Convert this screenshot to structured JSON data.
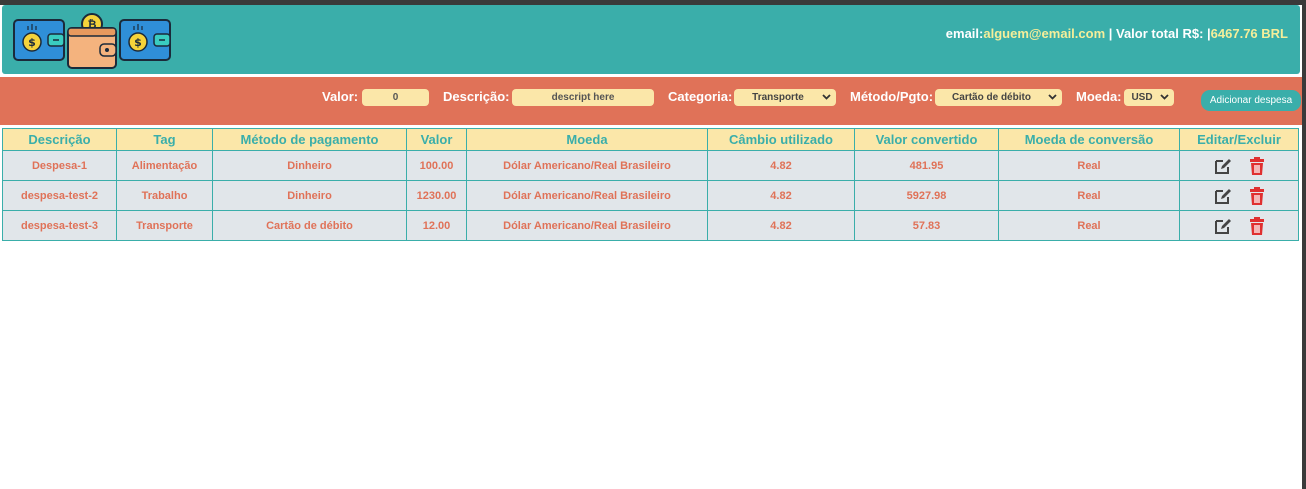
{
  "header": {
    "email_label": "email:",
    "email": "alguem@email.com",
    "total_label": " | Valor total R$: |",
    "total": "6467.76 BRL"
  },
  "form": {
    "valor_label": "Valor:",
    "valor_value": "0",
    "descricao_label": "Descrição:",
    "descricao_placeholder": "descript here",
    "categoria_label": "Categoria:",
    "categoria_value": "Transporte",
    "metodo_label": "Método/Pgto:",
    "metodo_value": "Cartão de débito",
    "moeda_label": "Moeda:",
    "moeda_value": "USD",
    "add_button": "Adicionar despesa"
  },
  "table": {
    "headers": [
      "Descrição",
      "Tag",
      "Método de pagamento",
      "Valor",
      "Moeda",
      "Câmbio utilizado",
      "Valor convertido",
      "Moeda de conversão",
      "Editar/Excluir"
    ],
    "rows": [
      [
        "Despesa-1",
        "Alimentação",
        "Dinheiro",
        "100.00",
        "Dólar Americano/Real Brasileiro",
        "4.82",
        "481.95",
        "Real"
      ],
      [
        "despesa-test-2",
        "Trabalho",
        "Dinheiro",
        "1230.00",
        "Dólar Americano/Real Brasileiro",
        "4.82",
        "5927.98",
        "Real"
      ],
      [
        "despesa-test-3",
        "Transporte",
        "Cartão de débito",
        "12.00",
        "Dólar Americano/Real Brasileiro",
        "4.82",
        "57.83",
        "Real"
      ]
    ]
  },
  "icons": {
    "edit": "edit-icon",
    "delete": "trash-icon",
    "logo": "wallet-coins-logo"
  },
  "colors": {
    "header": "#3aaeaa",
    "formbar": "#e07258",
    "accent_yellow": "#fbe7a9",
    "delete": "#e03030",
    "edit": "#444444"
  }
}
